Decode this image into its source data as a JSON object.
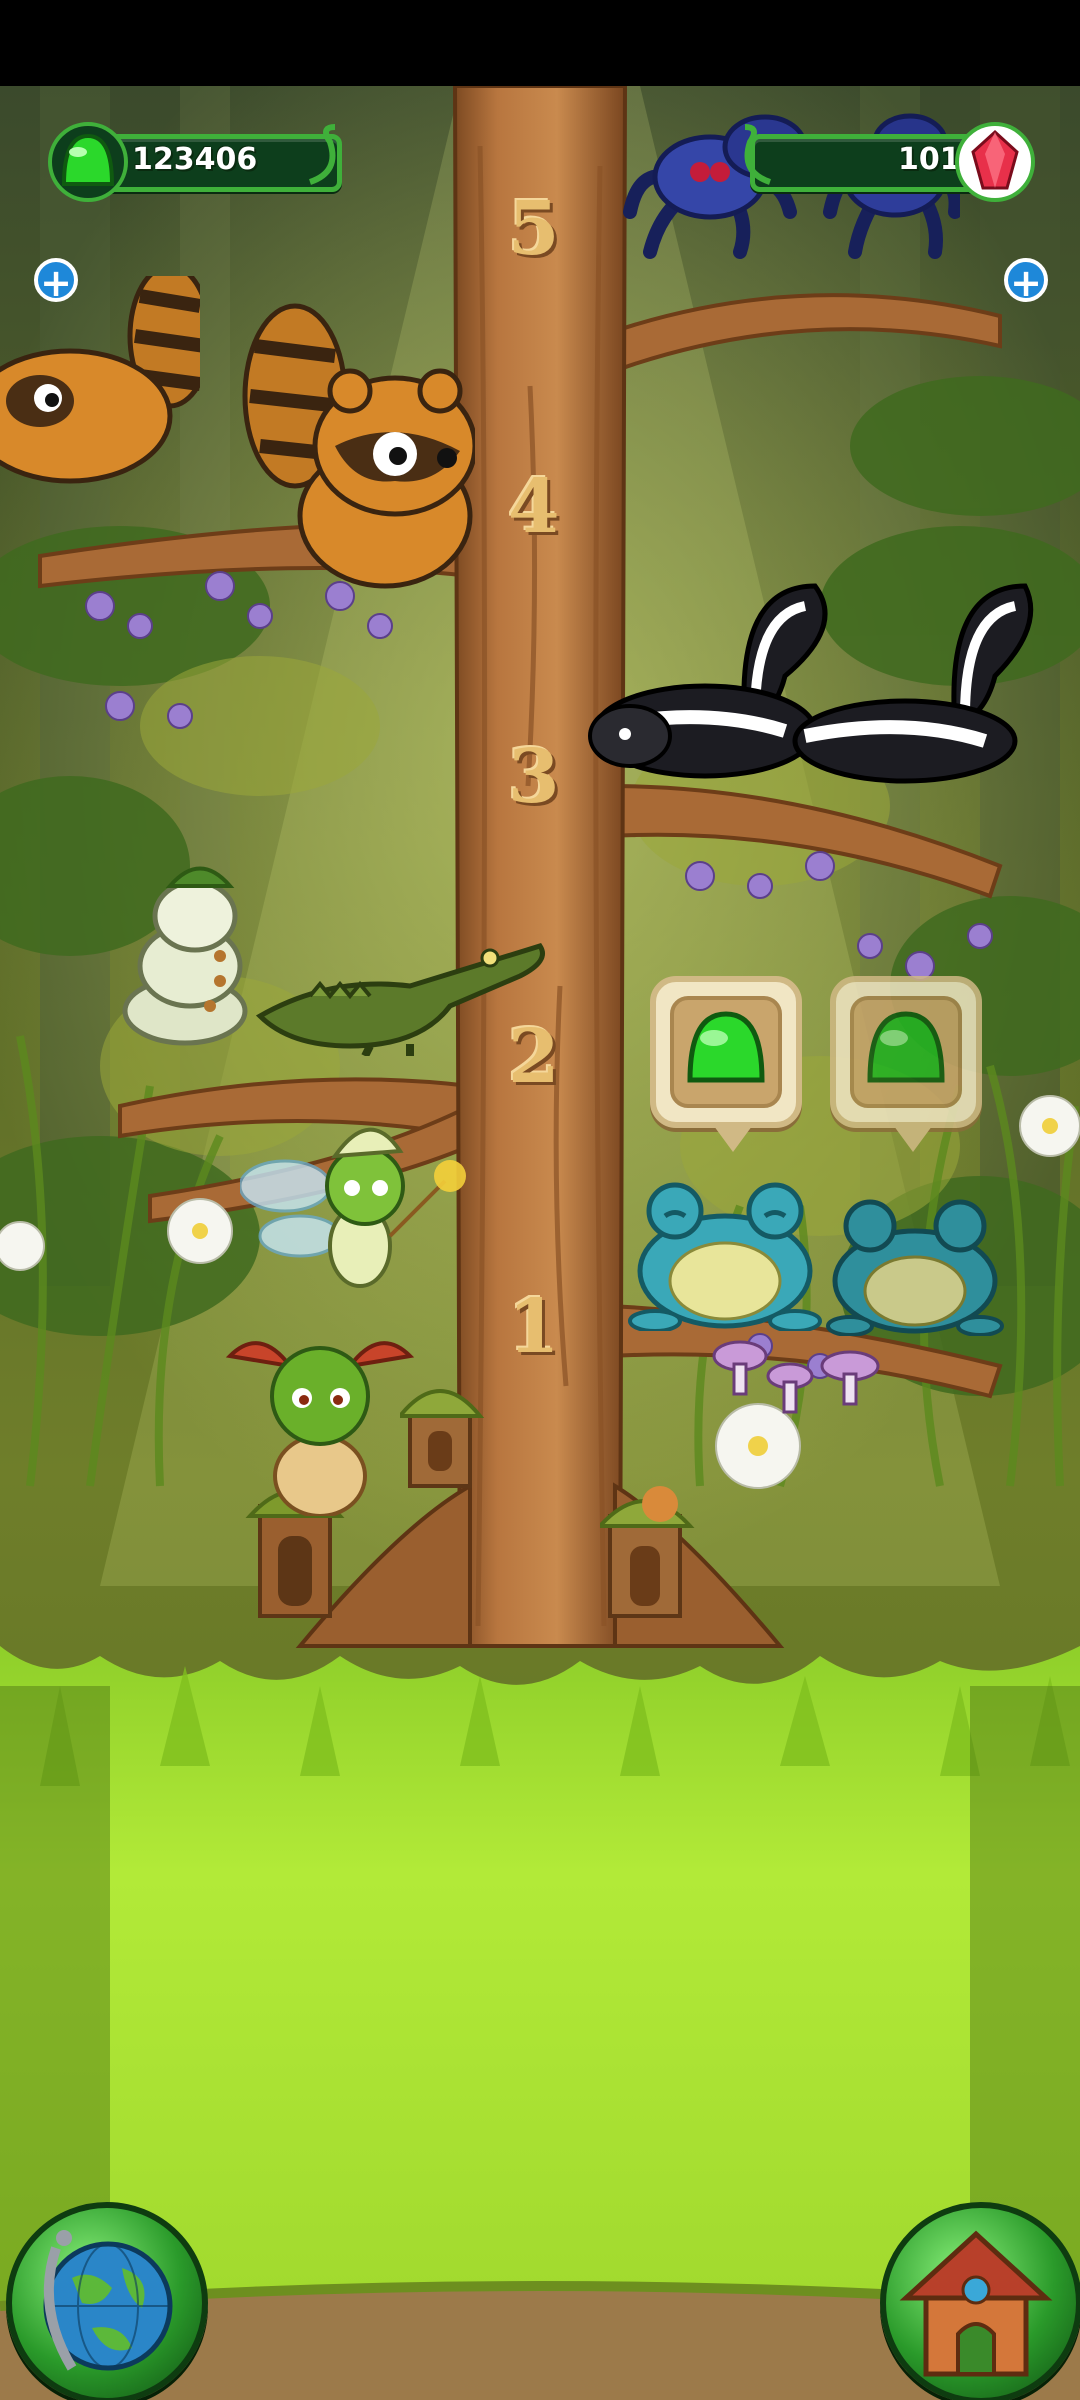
{
  "hud": {
    "currency": {
      "value": "123406",
      "icon": "green-jelly-icon",
      "add_icon": "plus-icon"
    },
    "gems": {
      "value": "101",
      "icon": "red-gem-icon",
      "add_icon": "plus-icon"
    }
  },
  "tree": {
    "levels": [
      "5",
      "4",
      "3",
      "2",
      "1"
    ]
  },
  "collect_bubbles": [
    {
      "icon": "green-jelly-icon"
    },
    {
      "icon": "green-jelly-icon"
    }
  ],
  "nav": {
    "left_button_icon": "globe-icon",
    "right_button_icon": "house-icon"
  },
  "colors": {
    "hud_bar": "#0d3e1c",
    "hud_border": "#3fb03a",
    "trunk": "#b8763f",
    "grass": "#a8e23a",
    "jelly": "#2bd82b",
    "gem": "#e8304a",
    "plus": "#1e88d9"
  }
}
